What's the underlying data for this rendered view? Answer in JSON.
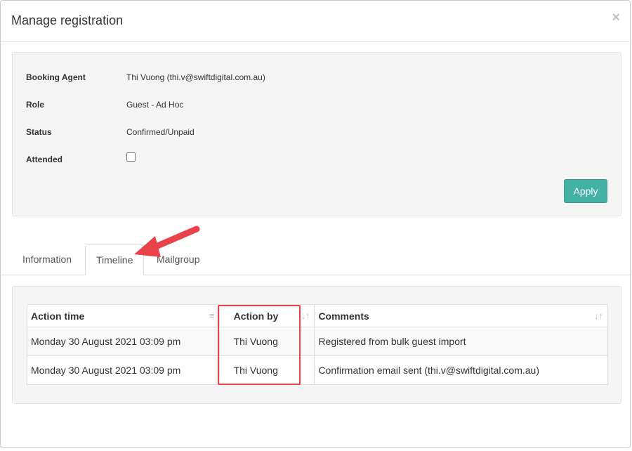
{
  "modal": {
    "title": "Manage registration",
    "close_label": "×"
  },
  "details": {
    "booking_agent_label": "Booking Agent",
    "booking_agent_value": "Thi Vuong (thi.v@swiftdigital.com.au)",
    "role_label": "Role",
    "role_value": "Guest - Ad Hoc",
    "status_label": "Status",
    "status_value": "Confirmed/Unpaid",
    "attended_label": "Attended",
    "attended_checked": false,
    "apply_label": "Apply"
  },
  "tabs": [
    {
      "label": "Information",
      "active": false
    },
    {
      "label": "Timeline",
      "active": true
    },
    {
      "label": "Mailgroup",
      "active": false
    }
  ],
  "timeline": {
    "headers": [
      "Action time",
      "Action by",
      "Comments"
    ],
    "rows": [
      [
        "Monday 30 August 2021 03:09 pm",
        "Thi Vuong",
        "Registered from bulk guest import"
      ],
      [
        "Monday 30 August 2021 03:09 pm",
        "Thi Vuong",
        "Confirmation email sent (thi.v@swiftdigital.com.au)"
      ]
    ]
  },
  "colors": {
    "accent": "#43b1a6",
    "annotation": "#e8434b"
  }
}
